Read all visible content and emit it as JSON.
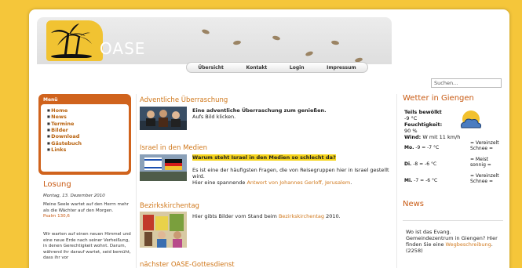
{
  "site": {
    "logo_text": "OASE"
  },
  "nav": {
    "items": [
      "Übersicht",
      "Kontakt",
      "Login",
      "Impressum"
    ]
  },
  "search": {
    "placeholder": "Suchen..."
  },
  "menu": {
    "title": "Menü",
    "items": [
      "Home",
      "News",
      "Termine",
      "Bilder",
      "Download",
      "Gästebuch",
      "Links"
    ]
  },
  "losung": {
    "title": "Losung",
    "date": "Montag, 13. Dezember 2010",
    "text1": "Meine Seele wartet auf den Herrn mehr als die Wächter auf den Morgen.",
    "ref1": "Psalm 130,6",
    "text2": "Wir warten auf einen neuen Himmel und eine neue Erde nach seiner Verheißung, in denen Gerechtigkeit wohnt. Darum, während ihr darauf wartet, seid bemüht, dass ihr vor"
  },
  "articles": [
    {
      "title": "Adventliche Überraschung",
      "bold": "Eine adventliche Überraschung zum genießen.",
      "text": "Aufs Bild klicken."
    },
    {
      "title": "Israel in den Medien",
      "highlight": "Warum steht Israel in den Medien so schlecht da?",
      "text": "Es ist eine der häufigsten Fragen, die von Reisegruppen hier in Israel gestellt wird.",
      "text2": "Hier eine spannende",
      "link": "Antwort von Johannes Gerloff, Jerusalem",
      "after": "."
    },
    {
      "title": "Bezirkskirchentag",
      "text": "Hier gibts Bilder vom Stand beim",
      "link": "Bezirkskirchentag",
      "after": "2010."
    },
    {
      "title": "nächster OASE-Gottesdienst"
    }
  ],
  "weather": {
    "title": "Wetter in Giengen",
    "condition": "Teils bewölkt",
    "temp": "-9 °C",
    "humidity_label": "Feuchtigkeit:",
    "humidity": "90 %",
    "wind_label": "Wind:",
    "wind": "W mit 11 km/h",
    "forecast": [
      {
        "day": "Mo.",
        "low": "-9",
        "high": "-7",
        "unit": "°C",
        "desc1": "= Vereinzelt",
        "desc2": "Schnee ="
      },
      {
        "day": "Di.",
        "low": "-8",
        "high": "-6",
        "unit": "°C",
        "desc1": "= Meist",
        "desc2": "sonnig ="
      },
      {
        "day": "Mi.",
        "low": "-7",
        "high": "-6",
        "unit": "°C",
        "desc1": "= Vereinzelt",
        "desc2": "Schnee ="
      }
    ]
  },
  "news": {
    "title": "News",
    "text": "Wo ist das Evang. Gemeindezentrum in Giengen? Hier finden Sie eine",
    "link": "Wegbeschreibung",
    "after": ". (2258)"
  },
  "colors": {
    "background": "#f5c63a",
    "accent": "#c85a13",
    "link": "#d0781c",
    "highlight": "#f6d41c"
  }
}
